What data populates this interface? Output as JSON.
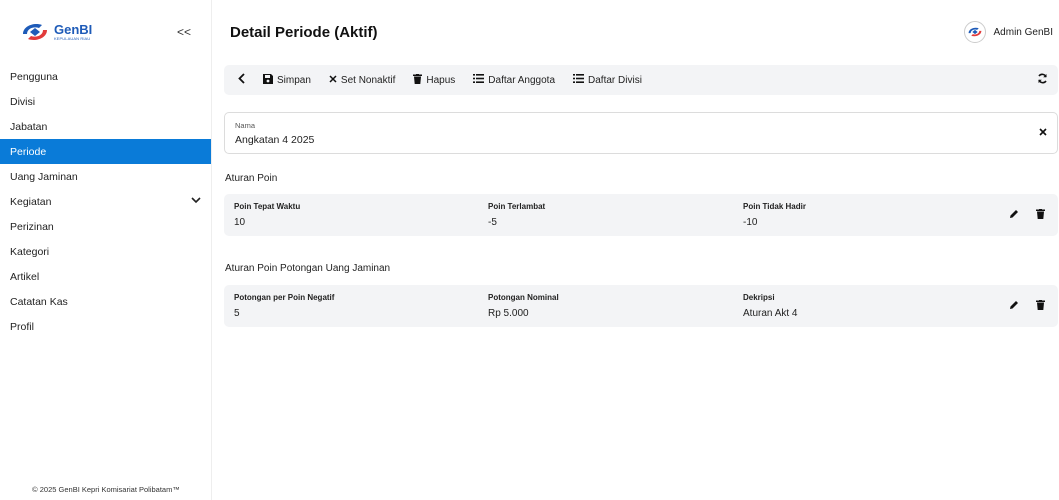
{
  "brand": {
    "title": "GenBI",
    "subtitle": "KEPULAUAN RIAU"
  },
  "sidebar": {
    "collapse_label": "<<",
    "items": [
      {
        "label": "Pengguna"
      },
      {
        "label": "Divisi"
      },
      {
        "label": "Jabatan"
      },
      {
        "label": "Periode",
        "active": true
      },
      {
        "label": "Uang Jaminan"
      },
      {
        "label": "Kegiatan",
        "has_submenu": true
      },
      {
        "label": "Perizinan"
      },
      {
        "label": "Kategori"
      },
      {
        "label": "Artikel"
      },
      {
        "label": "Catatan Kas"
      },
      {
        "label": "Profil"
      }
    ],
    "footer": "© 2025 GenBI Kepri Komisariat Polibatam™"
  },
  "header": {
    "title": "Detail Periode (Aktif)",
    "user_name": "Admin GenBI"
  },
  "toolbar": {
    "back_label": "<",
    "save_label": "Simpan",
    "deactivate_label": "Set Nonaktif",
    "delete_label": "Hapus",
    "members_label": "Daftar Anggota",
    "divisions_label": "Daftar Divisi"
  },
  "form": {
    "name_label": "Nama",
    "name_value": "Angkatan 4 2025"
  },
  "points_rules": {
    "title": "Aturan Poin",
    "columns": [
      {
        "header": "Poin Tepat Waktu",
        "value": "10"
      },
      {
        "header": "Poin Terlambat",
        "value": "-5"
      },
      {
        "header": "Poin Tidak Hadir",
        "value": "-10"
      }
    ]
  },
  "deduction_rules": {
    "title": "Aturan Poin Potongan Uang Jaminan",
    "columns": [
      {
        "header": "Potongan per Poin Negatif",
        "value": "5"
      },
      {
        "header": "Potongan Nominal",
        "value": "Rp 5.000"
      },
      {
        "header": "Dekripsi",
        "value": "Aturan Akt 4"
      }
    ]
  },
  "colors": {
    "accent": "#0a7bd8",
    "brand": "#1e5bb8",
    "card_bg": "#f3f4f6"
  },
  "icons": [
    "logo-icon",
    "chevron-left-icon",
    "save-icon",
    "close-icon",
    "trash-icon",
    "list-icon",
    "refresh-icon",
    "pencil-icon",
    "chevron-down-icon"
  ]
}
